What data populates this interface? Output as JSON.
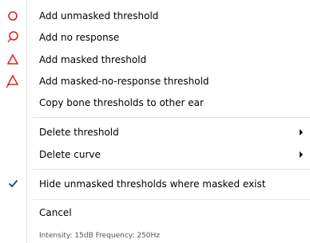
{
  "colors": {
    "marker_red": "#e02020",
    "check_blue": "#1f4e9c",
    "separator": "#e2e3e3"
  },
  "menu": {
    "items": [
      {
        "label": "Add unmasked threshold",
        "icon": "red-circle-icon"
      },
      {
        "label": "Add no response",
        "icon": "red-circle-no-response-icon"
      },
      {
        "label": "Add masked threshold",
        "icon": "red-triangle-icon"
      },
      {
        "label": "Add masked-no-response threshold",
        "icon": "red-triangle-no-response-icon"
      },
      {
        "label": "Copy bone thresholds to other ear"
      },
      {
        "label": "Delete threshold",
        "submenu": true
      },
      {
        "label": "Delete curve",
        "submenu": true
      },
      {
        "label": "Hide unmasked thresholds where masked exist",
        "checked": true,
        "icon": "checkmark-icon"
      },
      {
        "label": "Cancel"
      }
    ]
  },
  "status": {
    "text": "Intensity: 15dB Frequency: 250Hz"
  }
}
